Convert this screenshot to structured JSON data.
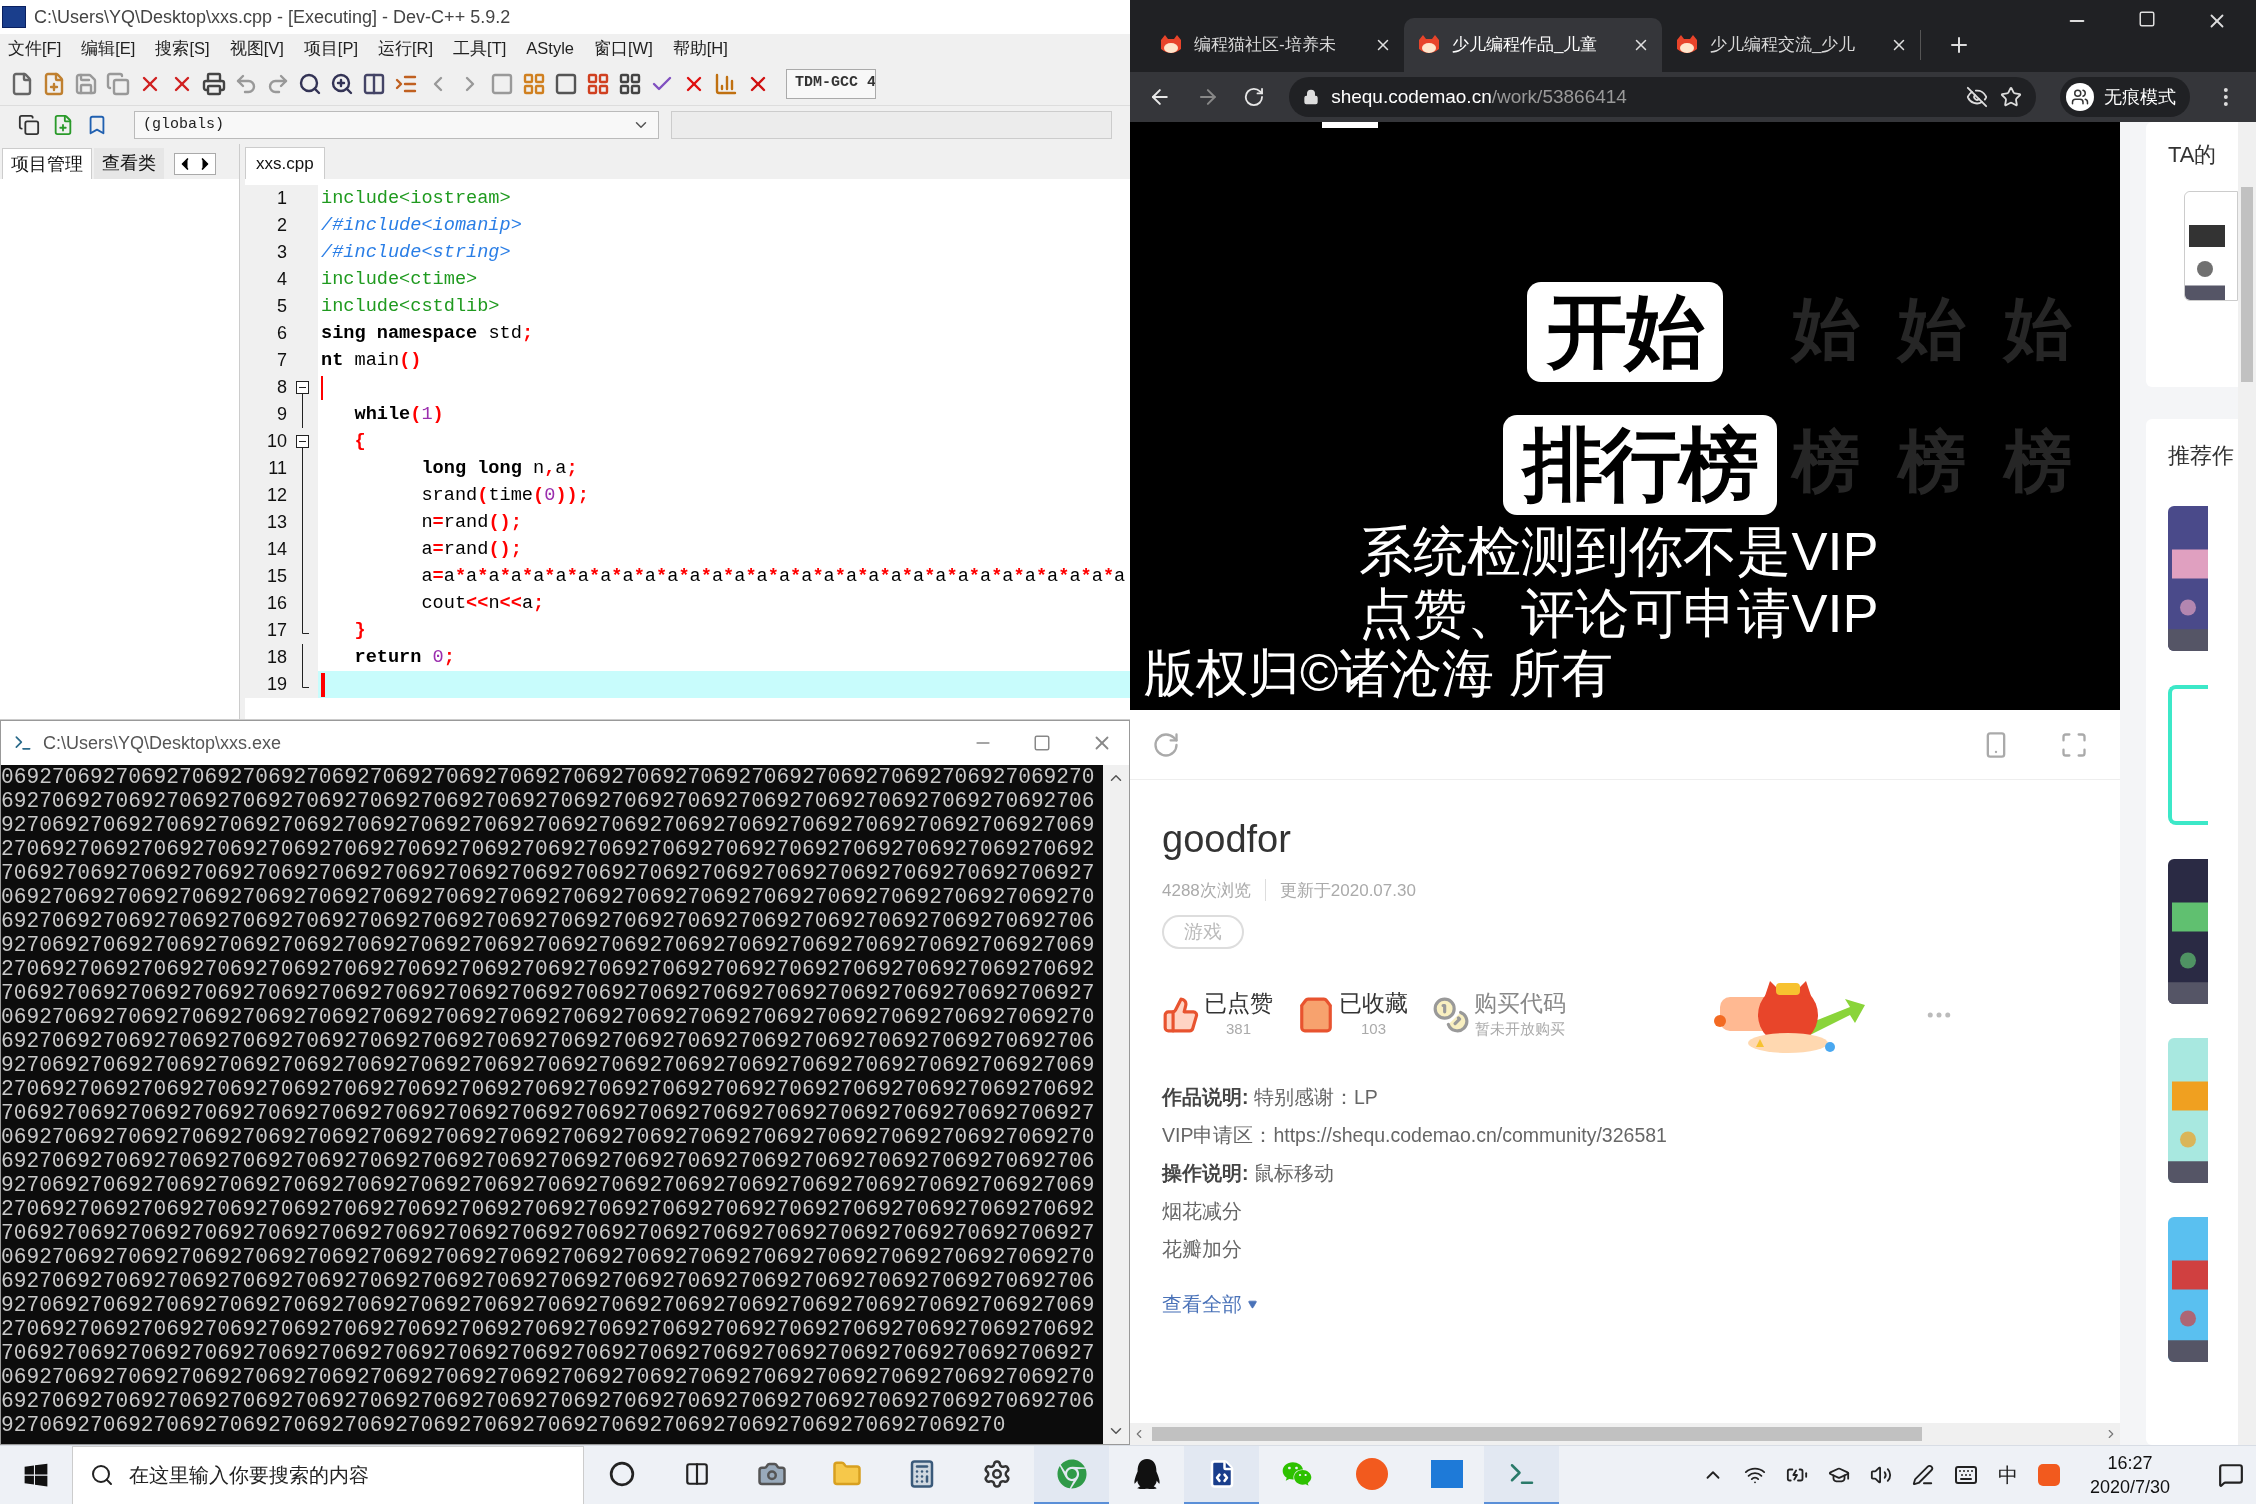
{
  "devcpp": {
    "title": "C:\\Users\\YQ\\Desktop\\xxs.cpp - [Executing] - Dev-C++ 5.9.2",
    "menu": [
      "文件[F]",
      "编辑[E]",
      "搜索[S]",
      "视图[V]",
      "项目[P]",
      "运行[R]",
      "工具[T]",
      "AStyle",
      "窗口[W]",
      "帮助[H]"
    ],
    "compiler_select": {
      "value": "TDM-GCC 4"
    },
    "scope_select": {
      "value": "(globals)"
    },
    "panel_tabs": [
      {
        "label": "项目管理",
        "selected": true
      },
      {
        "label": "查看类",
        "selected": false
      }
    ],
    "file_tabs": [
      {
        "label": "xxs.cpp",
        "selected": true
      }
    ],
    "code_lines": [
      {
        "number": "1",
        "kind": "plain",
        "caret": false,
        "current": false,
        "tokens": [
          {
            "kind": "pre",
            "text": "include<iostream>"
          }
        ]
      },
      {
        "number": "2",
        "kind": "plain",
        "caret": false,
        "current": false,
        "tokens": [
          {
            "kind": "comment",
            "text": "/#include<iomanip>"
          }
        ]
      },
      {
        "number": "3",
        "kind": "plain",
        "caret": false,
        "current": false,
        "tokens": [
          {
            "kind": "comment",
            "text": "/#include<string>"
          }
        ]
      },
      {
        "number": "4",
        "kind": "plain",
        "caret": false,
        "current": false,
        "tokens": [
          {
            "kind": "pre",
            "text": "include<ctime>"
          }
        ]
      },
      {
        "number": "5",
        "kind": "plain",
        "caret": false,
        "current": false,
        "tokens": [
          {
            "kind": "pre",
            "text": "include<cstdlib>"
          }
        ]
      },
      {
        "number": "6",
        "kind": "plain",
        "caret": false,
        "current": false,
        "tokens": [
          {
            "kind": "kw",
            "text": "sing"
          },
          {
            "kind": "kw",
            "text": " namespace"
          },
          {
            "kind": "plain",
            "text": " std"
          },
          {
            "kind": "sym",
            "text": ";"
          }
        ]
      },
      {
        "number": "7",
        "kind": "plain",
        "caret": false,
        "current": false,
        "tokens": [
          {
            "kind": "kw",
            "text": "nt"
          },
          {
            "kind": "plain",
            "text": " main"
          },
          {
            "kind": "sym",
            "text": "()"
          }
        ]
      },
      {
        "number": "8",
        "kind": "fold_start",
        "caret": true,
        "current": false
      },
      {
        "number": "9",
        "kind": "fold_line",
        "caret": false,
        "current": false,
        "tokens": [
          {
            "kind": "kw",
            "text": "   while"
          },
          {
            "kind": "sym",
            "text": "("
          },
          {
            "kind": "num",
            "text": "1"
          },
          {
            "kind": "sym",
            "text": ")"
          }
        ]
      },
      {
        "number": "10",
        "kind": "fold_start",
        "caret": false,
        "current": false,
        "tokens": [
          {
            "kind": "sym",
            "text": "   {"
          }
        ]
      },
      {
        "number": "11",
        "kind": "fold_line",
        "caret": false,
        "current": false,
        "tokens": [
          {
            "kind": "kw",
            "text": "         long long"
          },
          {
            "kind": "plain",
            "text": " n"
          },
          {
            "kind": "sym",
            "text": ","
          },
          {
            "kind": "plain",
            "text": "a"
          },
          {
            "kind": "sym",
            "text": ";"
          }
        ]
      },
      {
        "number": "12",
        "kind": "fold_line",
        "caret": false,
        "current": false,
        "tokens": [
          {
            "kind": "plain",
            "text": "         srand"
          },
          {
            "kind": "sym",
            "text": "("
          },
          {
            "kind": "plain",
            "text": "time"
          },
          {
            "kind": "sym",
            "text": "("
          },
          {
            "kind": "num",
            "text": "0"
          },
          {
            "kind": "sym",
            "text": "));"
          }
        ]
      },
      {
        "number": "13",
        "kind": "fold_line",
        "caret": false,
        "current": false,
        "tokens": [
          {
            "kind": "plain",
            "text": "         n"
          },
          {
            "kind": "sym",
            "text": "="
          },
          {
            "kind": "plain",
            "text": "rand"
          },
          {
            "kind": "sym",
            "text": "();"
          }
        ]
      },
      {
        "number": "14",
        "kind": "fold_line",
        "caret": false,
        "current": false,
        "tokens": [
          {
            "kind": "plain",
            "text": "         a"
          },
          {
            "kind": "sym",
            "text": "="
          },
          {
            "kind": "plain",
            "text": "rand"
          },
          {
            "kind": "sym",
            "text": "();"
          }
        ]
      },
      {
        "number": "15",
        "kind": "fold_line",
        "caret": false,
        "current": false,
        "tokens": [
          {
            "kind": "expr",
            "text": "         a=a*a*a*a*a*a*a*a*a*a*a*a*a*a*a*a*a*a*a*a*a*a*a*a*a*a*a*a*a*a*a"
          }
        ]
      },
      {
        "number": "16",
        "kind": "fold_line",
        "caret": false,
        "current": false,
        "tokens": [
          {
            "kind": "plain",
            "text": "         cout"
          },
          {
            "kind": "sym",
            "text": "<<"
          },
          {
            "kind": "plain",
            "text": "n"
          },
          {
            "kind": "sym",
            "text": "<<"
          },
          {
            "kind": "plain",
            "text": "a"
          },
          {
            "kind": "sym",
            "text": ";"
          }
        ]
      },
      {
        "number": "17",
        "kind": "fold_end",
        "caret": false,
        "current": false,
        "tokens": [
          {
            "kind": "sym",
            "text": "   }"
          }
        ]
      },
      {
        "number": "18",
        "kind": "fold_line",
        "caret": false,
        "current": false,
        "tokens": [
          {
            "kind": "kw",
            "text": "   return"
          },
          {
            "kind": "num",
            "text": " 0"
          },
          {
            "kind": "sym",
            "text": ";"
          }
        ]
      },
      {
        "number": "19",
        "kind": "fold_end",
        "caret": true,
        "current": true
      }
    ]
  },
  "console": {
    "title": "C:\\Users\\YQ\\Desktop\\xxs.exe",
    "lines": [
      "06927069270692706927069270692706927069270692706927069270692706927069270692706927069270",
      "69270692706927069270692706927069270692706927069270692706927069270692706927069270692706",
      "92706927069270692706927069270692706927069270692706927069270692706927069270692706927069",
      "27069270692706927069270692706927069270692706927069270692706927069270692706927069270692",
      "70692706927069270692706927069270692706927069270692706927069270692706927069270692706927",
      "06927069270692706927069270692706927069270692706927069270692706927069270692706927069270",
      "69270692706927069270692706927069270692706927069270692706927069270692706927069270692706",
      "92706927069270692706927069270692706927069270692706927069270692706927069270692706927069",
      "27069270692706927069270692706927069270692706927069270692706927069270692706927069270692",
      "70692706927069270692706927069270692706927069270692706927069270692706927069270692706927",
      "06927069270692706927069270692706927069270692706927069270692706927069270692706927069270",
      "69270692706927069270692706927069270692706927069270692706927069270692706927069270692706",
      "92706927069270692706927069270692706927069270692706927069270692706927069270692706927069",
      "27069270692706927069270692706927069270692706927069270692706927069270692706927069270692",
      "70692706927069270692706927069270692706927069270692706927069270692706927069270692706927",
      "06927069270692706927069270692706927069270692706927069270692706927069270692706927069270",
      "69270692706927069270692706927069270692706927069270692706927069270692706927069270692706",
      "92706927069270692706927069270692706927069270692706927069270692706927069270692706927069",
      "27069270692706927069270692706927069270692706927069270692706927069270692706927069270692",
      "70692706927069270692706927069270692706927069270692706927069270692706927069270692706927",
      "06927069270692706927069270692706927069270692706927069270692706927069270692706927069270",
      "69270692706927069270692706927069270692706927069270692706927069270692706927069270692706",
      "92706927069270692706927069270692706927069270692706927069270692706927069270692706927069",
      "27069270692706927069270692706927069270692706927069270692706927069270692706927069270692",
      "70692706927069270692706927069270692706927069270692706927069270692706927069270692706927",
      "06927069270692706927069270692706927069270692706927069270692706927069270692706927069270",
      "69270692706927069270692706927069270692706927069270692706927069270692706927069270692706",
      "9270692706927069270692706927069270692706927069270692706927069270692706927069270"
    ]
  },
  "browser": {
    "tabs": [
      {
        "label": "编程猫社区-培养未",
        "selected": false
      },
      {
        "label": "少儿编程作品_儿童",
        "selected": true
      },
      {
        "label": "少儿编程交流_少儿",
        "selected": false
      }
    ],
    "url": {
      "host": "shequ.codemao.cn",
      "path": "/work/53866414"
    },
    "profile": "无痕模式",
    "stage": {
      "buttons": [
        "开始",
        "排行榜"
      ],
      "ghosts": [
        "始  始  始",
        "榜  榜  榜"
      ],
      "notice": [
        "系统检测到你不是VIP",
        "点赞、评论可申请VIP"
      ],
      "copyright": "版权归©诸沧海 所有"
    },
    "work": {
      "title": "goodfor",
      "views": "4288次浏览",
      "updated": "更新于2020.07.30",
      "tags": [
        "游戏"
      ],
      "actions": [
        {
          "kind": "like",
          "label": "已点赞",
          "sub": "381",
          "done": true
        },
        {
          "kind": "collect",
          "label": "已收藏",
          "sub": "103",
          "done": true
        },
        {
          "kind": "buy",
          "label": "购买代码",
          "sub": "暂未开放购买",
          "done": false
        }
      ],
      "description": [
        "**作品说明:** 特别感谢：LP",
        "VIP申请区：https://shequ.codemao.cn/community/326581",
        "**操作说明:** 鼠标移动",
        "烟花减分",
        "花瓣加分"
      ],
      "view_all": "查看全部"
    },
    "sidebar": {
      "author_heading": "TA的",
      "recommend_heading": "推荐作"
    }
  },
  "taskbar": {
    "search": {
      "placeholder": "在这里输入你要搜索的内容"
    },
    "apps": [
      {
        "kind": "cortana",
        "running": false
      },
      {
        "kind": "taskview",
        "running": false
      },
      {
        "kind": "camera",
        "running": false
      },
      {
        "kind": "explorer",
        "running": false
      },
      {
        "kind": "calculator",
        "running": false
      },
      {
        "kind": "settings",
        "running": false
      },
      {
        "kind": "chrome",
        "running": true
      },
      {
        "kind": "qq",
        "running": false
      },
      {
        "kind": "devcpp",
        "running": true
      },
      {
        "kind": "wechat",
        "running": false
      },
      {
        "kind": "codemao",
        "running": false
      },
      {
        "kind": "puzzle",
        "running": false
      },
      {
        "kind": "console",
        "running": true
      }
    ],
    "ime": "中",
    "time": "16:27",
    "date": "2020/7/30"
  }
}
